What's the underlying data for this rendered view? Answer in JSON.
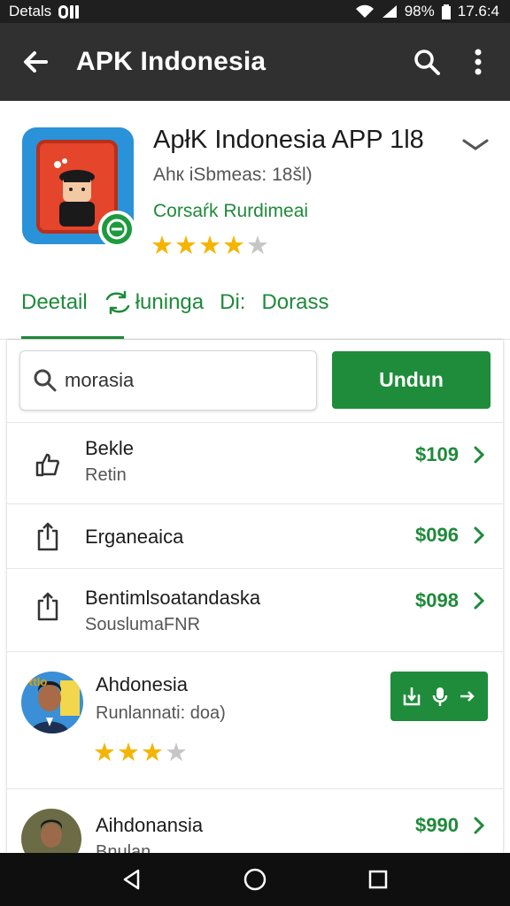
{
  "status_bar": {
    "left_text": "Detals",
    "right_battery": "98%",
    "right_time": "17.6:4"
  },
  "toolbar": {
    "title": "APK Indonesia",
    "back_icon": "arrow-back-icon",
    "search_icon": "search-icon",
    "menu_icon": "more-vert-icon"
  },
  "app": {
    "title": "ApłK Indonesia APP 1l8",
    "subtitle": "Ahк iSbmeas: 18šl)",
    "developer": "Corsaŕk Rurdimeai",
    "rating": {
      "value": 4,
      "max": 5
    },
    "accent_color": "#1e8a3a"
  },
  "tabs": [
    {
      "label": "Deetail"
    },
    {
      "label": "łuninga"
    },
    {
      "label": "Di:"
    },
    {
      "label": "Dorass"
    }
  ],
  "search": {
    "value": "morasia",
    "placeholder": "morasia"
  },
  "download_button": {
    "label": "Undun"
  },
  "list": [
    {
      "title": "Bekle",
      "sub": "Retin",
      "price": "$109",
      "icon": "thumbs-up-icon"
    },
    {
      "title": "Erganeaica",
      "price": "$096",
      "icon": "share-icon"
    },
    {
      "title": "Bentimlsoatandaska",
      "sub": "SouslumaFNR",
      "price": "$098",
      "icon": "share-icon"
    }
  ],
  "featured": {
    "title": "Ahdonesia",
    "sub": "Runlannati: doa)",
    "rating": {
      "value": 3,
      "max": 4
    },
    "avatar_badge": "Rtlo"
  },
  "last_item": {
    "title": "Aihdonansia",
    "sub": "Bnulan",
    "price": "$990"
  },
  "nav": {
    "back": "nav-back-icon",
    "home": "nav-home-icon",
    "recents": "nav-recents-icon"
  }
}
